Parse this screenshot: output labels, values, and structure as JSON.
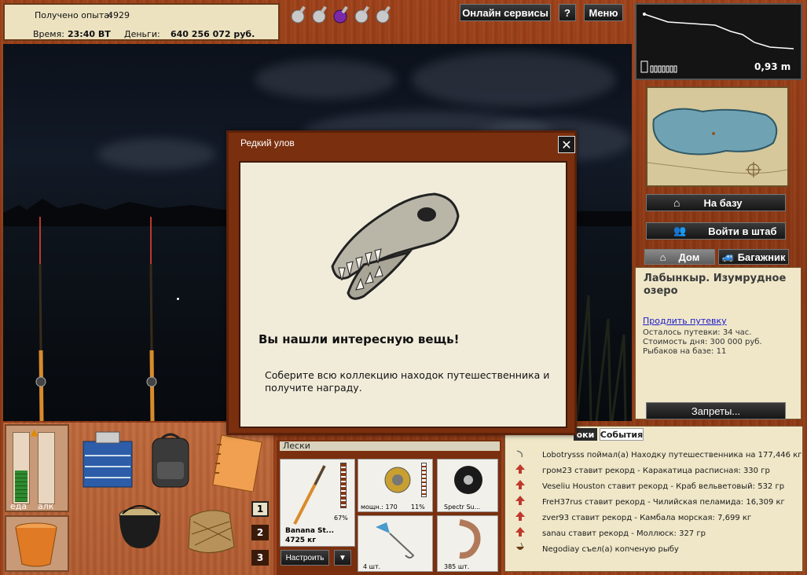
{
  "top": {
    "experience_label": "Получено опыта:",
    "experience_value": "4929",
    "time_label": "Время:",
    "time_value": "23:40 ВТ",
    "money_label": "Деньги:",
    "money_value": "640 256 072 руб."
  },
  "header_buttons": {
    "online_services": "Онлайн сервисы",
    "help": "?",
    "menu": "Меню"
  },
  "depth_chart": {
    "value": "0,93 m"
  },
  "side_buttons": {
    "to_base": "На базу",
    "hq": "Войти в штаб",
    "home": "Дом",
    "trunk": "Багажник",
    "bans": "Запреты..."
  },
  "location": {
    "name": "Лабынкыр. Изумрудное озеро",
    "extend_link": "Продлить путевку",
    "days_left": "Осталось путевки: 34 час.",
    "day_cost": "Стоимость дня: 300 000 руб.",
    "fishers": "Рыбаков на базе: 11"
  },
  "modal": {
    "title": "Редкий улов",
    "heading": "Вы нашли интересную вещь!",
    "body": "Соберите всю коллекцию находок путешественника и получите награду."
  },
  "status_bars": {
    "food_label": "еда",
    "alc_label": "алк",
    "food_level": 0.45,
    "alc_level": 0.0
  },
  "slot_numbers": [
    "1",
    "2",
    "3"
  ],
  "tackle": {
    "section_label": "Лески",
    "rod_name": "Banana St...",
    "rod_weight": "4725 кг",
    "rod_percent": "67%",
    "reel_power": "мощн.: 170",
    "reel_percent": "11%",
    "line_name": "Spectr Su...",
    "hook_count": "4 шт.",
    "bait_count": "385 шт.",
    "setup_button": "Настроить",
    "dropdown": "▼"
  },
  "tabs": {
    "tab_1": "оки",
    "tab_2": "События"
  },
  "events": [
    {
      "icon": "hook-icon",
      "text": "Lobotrysss поймал(а) Находку путешественника на 177,446 кг"
    },
    {
      "icon": "record-arrow-icon",
      "text": "гром23 ставит рекорд - Каракатица расписная: 330 гр"
    },
    {
      "icon": "record-arrow-icon",
      "text": "Veseliu Houston ставит рекорд - Краб вельветовый: 532 гр"
    },
    {
      "icon": "record-arrow-icon",
      "text": "FreH37rus ставит рекорд - Чилийская пеламида: 16,309 кг"
    },
    {
      "icon": "record-arrow-icon",
      "text": "zver93 ставит рекорд - Камбала морская: 7,699 кг"
    },
    {
      "icon": "record-arrow-icon",
      "text": "sanau ставит рекорд - Моллюск: 327 гр"
    },
    {
      "icon": "food-bowl-icon",
      "text": "Negodiay съел(а) копченую рыбу"
    }
  ],
  "colors": {
    "wood": "#8a3612",
    "cream": "#efe7c8",
    "record_red": "#c0392b",
    "link": "#1a1acc"
  }
}
